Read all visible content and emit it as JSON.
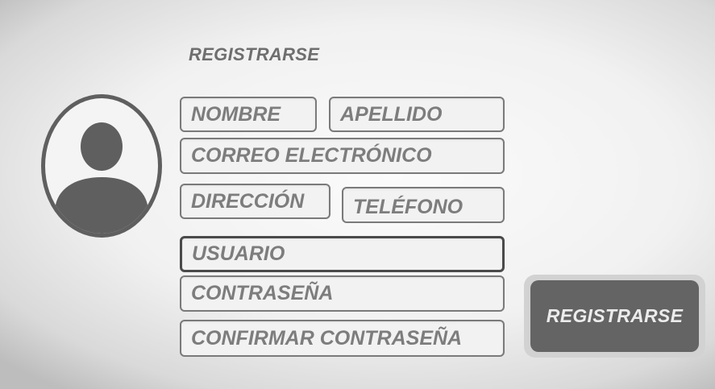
{
  "header": {
    "title": "REGISTRARSE"
  },
  "form": {
    "nombre": "NOMBRE",
    "apellido": "APELLIDO",
    "correo": "CORREO ELECTRÓNICO",
    "direccion": "DIRECCIÓN",
    "telefono": "TELÉFONO",
    "usuario": "USUARIO",
    "contrasena": "CONTRASEÑA",
    "confirmar_contrasena": "CONFIRMAR CONTRASEÑA"
  },
  "actions": {
    "register_label": "REGISTRARSE"
  },
  "avatar": {
    "icon": "user-silhouette-icon"
  },
  "colors": {
    "button_bg": "#646464",
    "button_frame": "#d2d2d2",
    "field_border": "#7a7a7a",
    "field_text": "#7d7d7d",
    "avatar": "#5f5f5f"
  }
}
